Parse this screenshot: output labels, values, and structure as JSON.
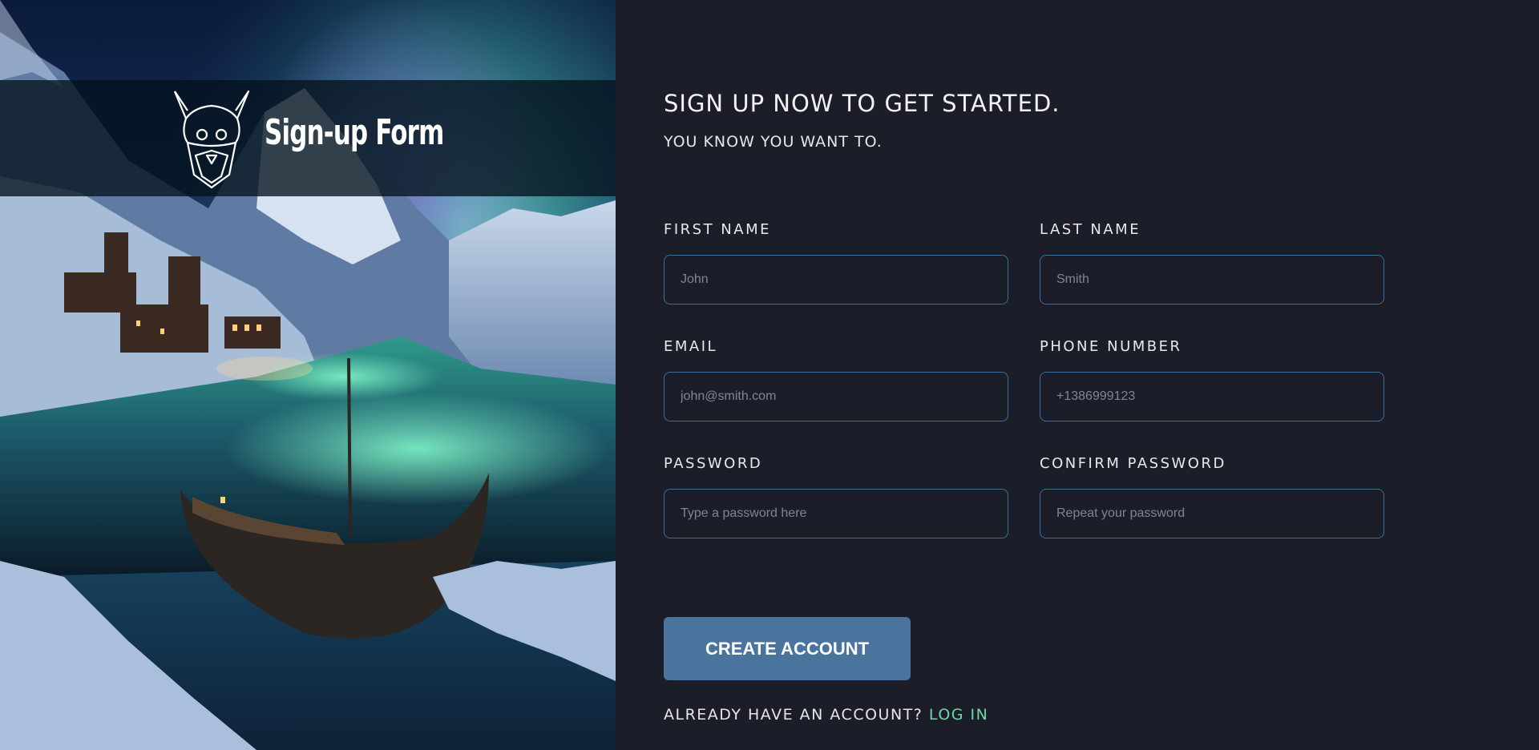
{
  "hero": {
    "logo_icon": "viking-helmet-icon",
    "banner_title": "Sign-up Form"
  },
  "form": {
    "heading": "SIGN UP NOW TO GET STARTED.",
    "subheading": "YOU KNOW YOU WANT TO.",
    "fields": [
      {
        "label": "FIRST NAME",
        "placeholder": "John",
        "value": ""
      },
      {
        "label": "LAST NAME",
        "placeholder": "Smith",
        "value": ""
      },
      {
        "label": "EMAIL",
        "placeholder": "john@smith.com",
        "value": ""
      },
      {
        "label": "PHONE NUMBER",
        "placeholder": "+1386999123",
        "value": ""
      },
      {
        "label": "PASSWORD",
        "placeholder": "Type a password here",
        "value": ""
      },
      {
        "label": "CONFIRM PASSWORD",
        "placeholder": "Repeat your password",
        "value": ""
      }
    ],
    "create_button": "CREATE ACCOUNT",
    "login_prompt": "ALREADY HAVE AN ACCOUNT?",
    "login_link": "LOG IN"
  },
  "colors": {
    "background": "#1b1e28",
    "input_border": "#3c6f99",
    "button": "#4a739d",
    "link": "#6fd7a6"
  }
}
